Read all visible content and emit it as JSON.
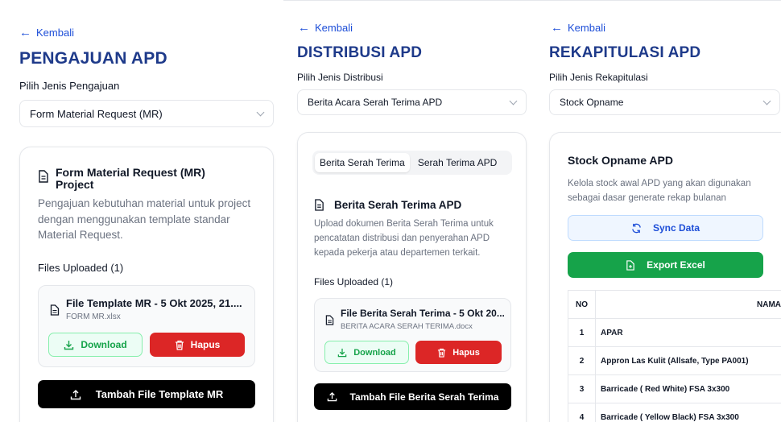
{
  "panels": {
    "mr": {
      "back": "Kembali",
      "title": "PENGAJUAN APD",
      "select_label": "Pilih Jenis Pengajuan",
      "select_value": "Form Material Request (MR)",
      "card_title_1": "Form Material Request (MR)",
      "card_title_2": "Project",
      "card_desc": "Pengajuan kebutuhan material untuk project dengan menggunakan template standar Material Request.",
      "files_label": "Files Uploaded (1)",
      "file_name": "File Template MR - 5 Okt 2025, 21....",
      "file_sub": "FORM MR.xlsx",
      "download": "Download",
      "delete": "Hapus",
      "add": "Tambah File Template MR"
    },
    "dist": {
      "back": "Kembali",
      "title": "DISTRIBUSI APD",
      "select_label": "Pilih Jenis Distribusi",
      "select_value": "Berita Acara Serah Terima APD",
      "tabs": [
        "Berita Serah Terima",
        "Serah Terima APD"
      ],
      "card_title": "Berita Serah Terima APD",
      "card_desc": "Upload dokumen Berita Serah Terima untuk pencatatan distribusi dan penyerahan APD kepada pekerja atau departemen terkait.",
      "files_label": "Files Uploaded (1)",
      "file_name": "File Berita Serah Terima - 5 Okt 20...",
      "file_sub": "BERITA ACARA SERAH TERIMA.docx",
      "download": "Download",
      "delete": "Hapus",
      "add": "Tambah File Berita Serah Terima"
    },
    "rekap": {
      "back": "Kembali",
      "title": "REKAPITULASI APD",
      "select_label": "Pilih Jenis Rekapitulasi",
      "select_value": "Stock Opname",
      "card_title": "Stock Opname APD",
      "card_desc": "Kelola stock awal APD yang akan digunakan sebagai dasar generate rekap bulanan",
      "sync": "Sync Data",
      "export": "Export Excel",
      "table": {
        "headers": [
          "NO",
          "NAMA"
        ],
        "rows": [
          {
            "no": "1",
            "name": "APAR"
          },
          {
            "no": "2",
            "name": "Appron Las Kulit (Allsafe, Type PA001)"
          },
          {
            "no": "3",
            "name": "Barricade ( Red White) FSA 3x300"
          },
          {
            "no": "4",
            "name": "Barricade ( Yellow Black) FSA 3x300"
          }
        ]
      }
    }
  },
  "colors": {
    "title": "#1e3a8a",
    "link": "#1d4ed8",
    "danger": "#dc2626",
    "success": "#16a34a"
  }
}
